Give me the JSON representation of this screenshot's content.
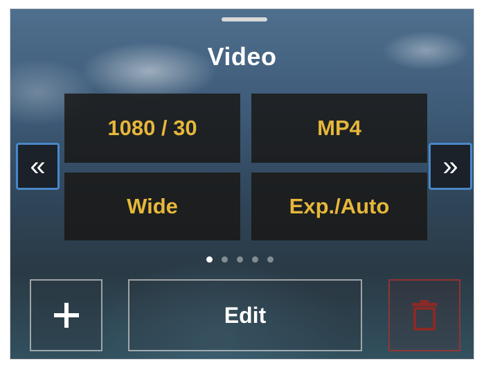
{
  "header": {
    "title": "Video"
  },
  "settings": {
    "resolution": "1080 / 30",
    "format": "MP4",
    "fov": "Wide",
    "exposure": "Exp./Auto"
  },
  "nav": {
    "prev_glyph": "«",
    "next_glyph": "»"
  },
  "pagination": {
    "total": 5,
    "current": 1
  },
  "actions": {
    "edit_label": "Edit",
    "add_icon": "plus-icon",
    "delete_icon": "trash-icon"
  },
  "colors": {
    "accent": "#e6b73a",
    "highlight": "#4a88c9",
    "delete": "#b0322d"
  }
}
